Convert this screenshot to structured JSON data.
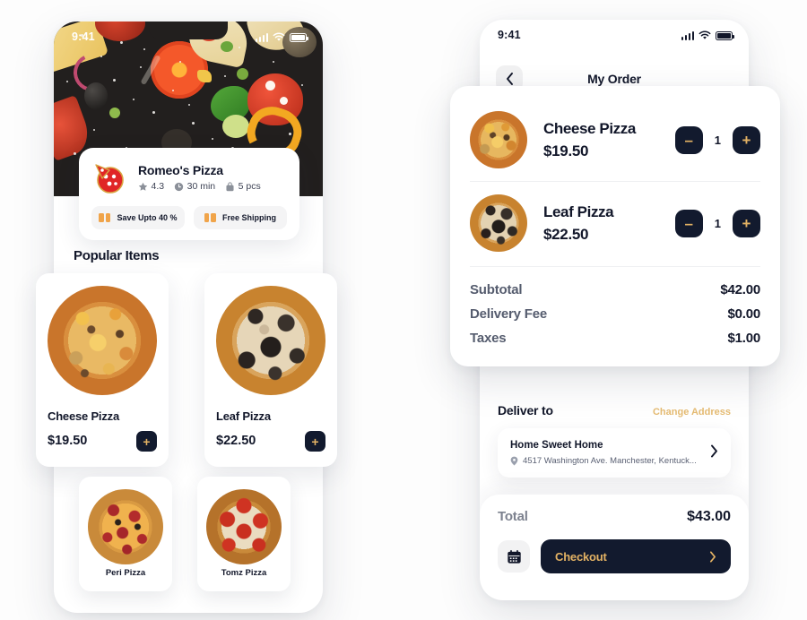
{
  "colors": {
    "accent_gold": "#e3b264",
    "dark_navy": "#121a2e",
    "orange": "#f0a44a",
    "page_bg": "#fdfdfd"
  },
  "left_phone": {
    "status_bar": {
      "time": "9:41",
      "signal_icon": "cellular-bars-icon",
      "wifi_icon": "wifi-icon",
      "battery_icon": "battery-icon"
    },
    "restaurant": {
      "logo_icon": "pizza-slice-logo-icon",
      "name": "Romeo's Pizza",
      "meta": [
        {
          "icon": "star-icon",
          "text": "4.3"
        },
        {
          "icon": "clock-icon",
          "text": "30 min"
        },
        {
          "icon": "bag-icon",
          "text": "5 pcs"
        }
      ],
      "chips": [
        {
          "icon": "ticket-icon",
          "label": "Save Upto 40 %"
        },
        {
          "icon": "ticket-icon",
          "label": "Free Shipping"
        }
      ]
    },
    "popular": {
      "title": "Popular Items",
      "items": [
        {
          "name": "Cheese Pizza",
          "price": "$19.50",
          "add_label": "+"
        },
        {
          "name": "Leaf Pizza",
          "price": "$22.50",
          "add_label": "+"
        }
      ],
      "more_items": [
        {
          "name": "Peri Pizza"
        },
        {
          "name": "Tomz Pizza"
        }
      ]
    }
  },
  "right_phone": {
    "status_bar": {
      "time": "9:41",
      "signal_icon": "cellular-bars-icon",
      "wifi_icon": "wifi-icon",
      "battery_icon": "battery-icon"
    },
    "header": {
      "back_icon": "chevron-left-icon",
      "title": "My Order"
    },
    "deliver": {
      "label": "Deliver to",
      "change_label": "Change Address",
      "address_name": "Home Sweet Home",
      "address_line": "4517 Washington Ave. Manchester, Kentuck...",
      "pin_icon": "location-pin-icon",
      "chevron_icon": "chevron-right-icon"
    },
    "footer": {
      "total_label": "Total",
      "total_value": "$43.00",
      "calendar_icon": "calendar-icon",
      "checkout_label": "Checkout",
      "checkout_chevron": "chevron-right-icon"
    }
  },
  "order_card": {
    "items": [
      {
        "name": "Cheese Pizza",
        "price": "$19.50",
        "qty": "1",
        "minus": "–",
        "plus": "+"
      },
      {
        "name": "Leaf Pizza",
        "price": "$22.50",
        "qty": "1",
        "minus": "–",
        "plus": "+"
      }
    ],
    "summary": [
      {
        "label": "Subtotal",
        "value": "$42.00"
      },
      {
        "label": "Delivery Fee",
        "value": "$0.00"
      },
      {
        "label": "Taxes",
        "value": "$1.00"
      }
    ]
  }
}
